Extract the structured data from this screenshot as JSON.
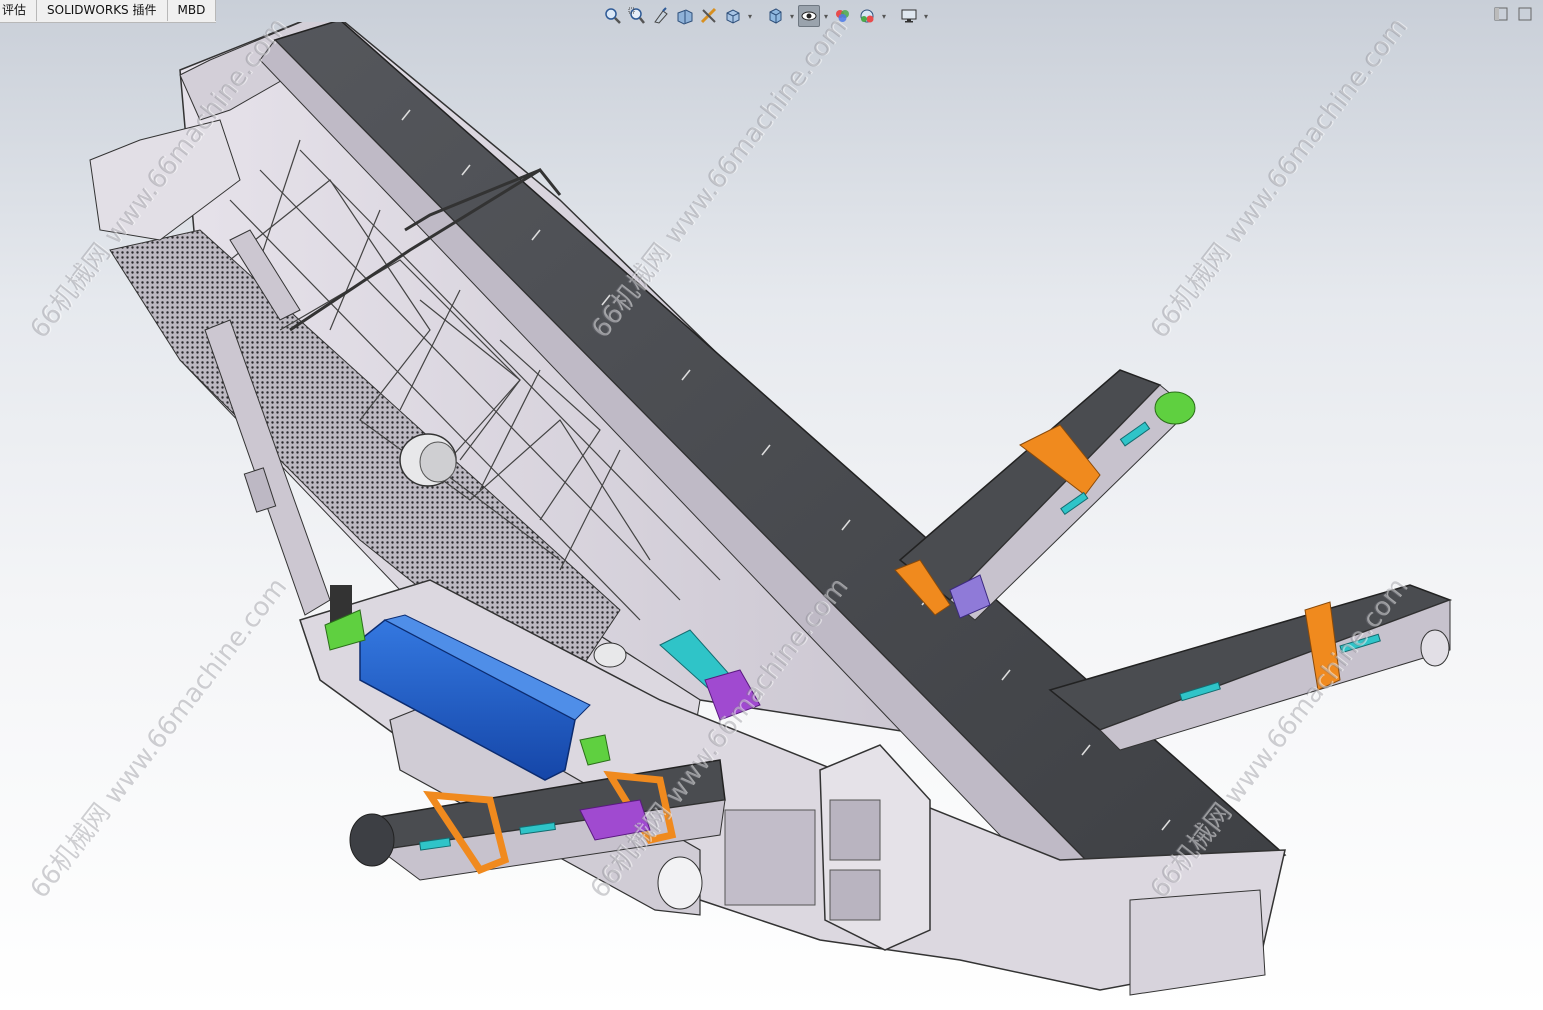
{
  "tabs": [
    {
      "label": "评估"
    },
    {
      "label": "SOLIDWORKS 插件"
    },
    {
      "label": "MBD"
    }
  ],
  "heads_up_toolbar": [
    {
      "icon": "zoom-to-fit-icon"
    },
    {
      "icon": "zoom-to-area-icon"
    },
    {
      "icon": "previous-view-icon"
    },
    {
      "icon": "section-view-icon"
    },
    {
      "icon": "dynamic-annotation-icon"
    },
    {
      "icon": "view-orientation-icon"
    },
    {
      "icon": "display-style-icon"
    },
    {
      "icon": "hide-show-items-icon"
    },
    {
      "icon": "edit-appearance-icon"
    },
    {
      "icon": "apply-scene-icon"
    },
    {
      "icon": "view-settings-icon"
    }
  ],
  "watermark": {
    "text": "66机械网 www.66machine.com"
  },
  "colors": {
    "belt": "#4a4c50",
    "frame": "#d6d2da",
    "hopper_blue": "#1f5ec8",
    "orange_bracket": "#f08a1e",
    "cyan_parts": "#2fc4c8",
    "purple_parts": "#a04ad0",
    "green_parts": "#5fd040"
  }
}
